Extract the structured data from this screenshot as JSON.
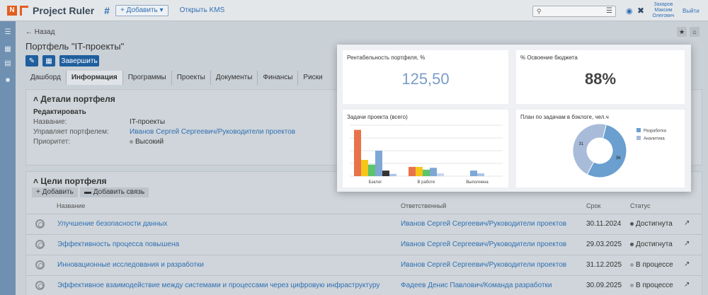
{
  "topbar": {
    "logo_letter": "N",
    "app_name": "Project Ruler",
    "add_label": "+ Добавить ▾",
    "open_kms": "Открыть KMS",
    "user_line1": "Захаров",
    "user_line2": "Максим",
    "user_line3": "Олегович",
    "logout": "Выйти"
  },
  "page": {
    "back": "← Назад",
    "title": "Портфель \"IT-проекты\"",
    "finish_label": "Завершить"
  },
  "tabs": [
    {
      "label": "Дашборд"
    },
    {
      "label": "Информация"
    },
    {
      "label": "Программы"
    },
    {
      "label": "Проекты"
    },
    {
      "label": "Документы"
    },
    {
      "label": "Финансы"
    },
    {
      "label": "Риски"
    }
  ],
  "details": {
    "title": "Детали портфеля",
    "edit": "Редактировать",
    "name_label": "Название:",
    "name_value": "IT-проекты",
    "manager_label": "Управляет портфелем:",
    "manager_value": "Иванов Сергей Сергеевич/Руководители проектов",
    "priority_label": "Приоритет:",
    "priority_value": "Высокий"
  },
  "goals": {
    "title": "Цели портфеля",
    "add_label": "Добавить",
    "add_link_label": "Добавить связь",
    "col_name": "Название",
    "col_resp": "Ответственный",
    "col_date": "Срок",
    "col_status": "Статус",
    "rows": [
      {
        "name": "Улучшение безопасности данных",
        "resp": "Иванов Сергей Сергеевич/Руководители проектов",
        "date": "30.11.2024",
        "status": "Достигнута",
        "status_color": "#555555"
      },
      {
        "name": "Эффективность процесса повышена",
        "resp": "Иванов Сергей Сергеевич/Руководители проектов",
        "date": "29.03.2025",
        "status": "Достигнута",
        "status_color": "#555555"
      },
      {
        "name": "Инновационные исследования и разработки",
        "resp": "Иванов Сергей Сергеевич/Руководители проектов",
        "date": "31.12.2025",
        "status": "В процессе",
        "status_color": "#9aa0a6"
      },
      {
        "name": "Эффективное взаимодействие между системами и процессами через цифровую инфраструктуру",
        "resp": "Фадеев Денис Павлович/Команда разработки",
        "date": "30.09.2025",
        "status": "В процессе",
        "status_color": "#9aa0a6"
      }
    ]
  },
  "dashboard": {
    "kpi1_title": "Рентабельность портфеля, %",
    "kpi1_value": "125,50",
    "kpi2_title": "% Освоение бюджета",
    "kpi2_value": "88%",
    "bar_title": "Задачи проекта (всего)",
    "pie_title": "План по задачам в бэклоге, чел.ч"
  },
  "chart_data": [
    {
      "type": "bar",
      "title": "Задачи проекта (всего)",
      "categories": [
        "Бэклог",
        "В работе",
        "Выполнена"
      ],
      "series": [
        {
          "color": "#e8734a",
          "values": [
            10,
            2,
            0
          ]
        },
        {
          "color": "#f5c518",
          "values": [
            3.5,
            2,
            0
          ]
        },
        {
          "color": "#5cc46a",
          "values": [
            2.5,
            1.4,
            0
          ]
        },
        {
          "color": "#7ea7d6",
          "values": [
            5.5,
            1.8,
            1.2
          ]
        },
        {
          "color": "#333333",
          "values": [
            1.2,
            0,
            0
          ]
        },
        {
          "color": "#a9c4e8",
          "values": [
            0.5,
            0,
            0.6
          ]
        },
        {
          "color": "#c5d6ee",
          "values": [
            0,
            0.6,
            0
          ]
        }
      ],
      "ylim": [
        0,
        11
      ],
      "grid": true
    },
    {
      "type": "pie",
      "title": "План по задачам в бэклоге, чел.ч",
      "legend_placement": "right",
      "slices": [
        {
          "label": "Разработка",
          "value": 36,
          "color": "#6a9fcf"
        },
        {
          "label": "Аналитика",
          "value": 31,
          "color": "#a8bcd9"
        }
      ]
    }
  ]
}
